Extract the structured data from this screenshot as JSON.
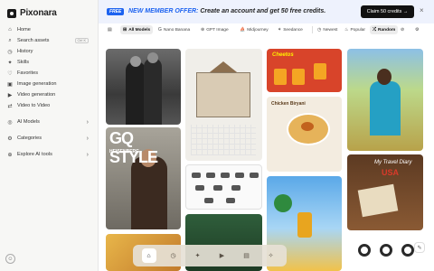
{
  "app": {
    "name": "Pixonara"
  },
  "sidebar": {
    "items": [
      {
        "label": "Home",
        "icon": "home-icon"
      },
      {
        "label": "Search assets",
        "icon": "search-icon",
        "shortcut": "Ctrl K"
      },
      {
        "label": "History",
        "icon": "clock-icon"
      },
      {
        "label": "Skills",
        "icon": "skills-icon"
      },
      {
        "label": "Favorites",
        "icon": "heart-icon"
      },
      {
        "label": "Image generation",
        "icon": "image-icon"
      },
      {
        "label": "Video generation",
        "icon": "video-icon"
      },
      {
        "label": "Video to Video",
        "icon": "video-to-video-icon"
      }
    ],
    "sections": [
      {
        "label": "AI Models",
        "icon": "ai-models-icon"
      },
      {
        "label": "Categories",
        "icon": "categories-icon"
      },
      {
        "label": "Explore AI tools",
        "icon": "compass-icon"
      }
    ]
  },
  "promo": {
    "badge": "FREE",
    "highlight": "NEW MEMBER OFFER:",
    "text": "Create an account and get 50 free credits.",
    "cta": "Claim 50 credits →"
  },
  "filters": {
    "models": [
      "All Models",
      "Nano Banana",
      "GPT Image",
      "Midjourney",
      "Seedance"
    ],
    "sort": [
      "Newest",
      "Popular",
      "Random"
    ],
    "active_model": "All Models",
    "active_sort": "Random"
  },
  "gallery": {
    "gq_title": "GQ STYLE",
    "gq_name": "HEISENBERG",
    "cheetos_label": "Cheetos",
    "biryani_title": "Chicken Biryani",
    "travel_title": "My Travel Diary",
    "travel_country": "USA"
  },
  "colors": {
    "accent": "#1d63f0",
    "promo_bg": "#eef2fd",
    "cta_bg": "#111111"
  }
}
